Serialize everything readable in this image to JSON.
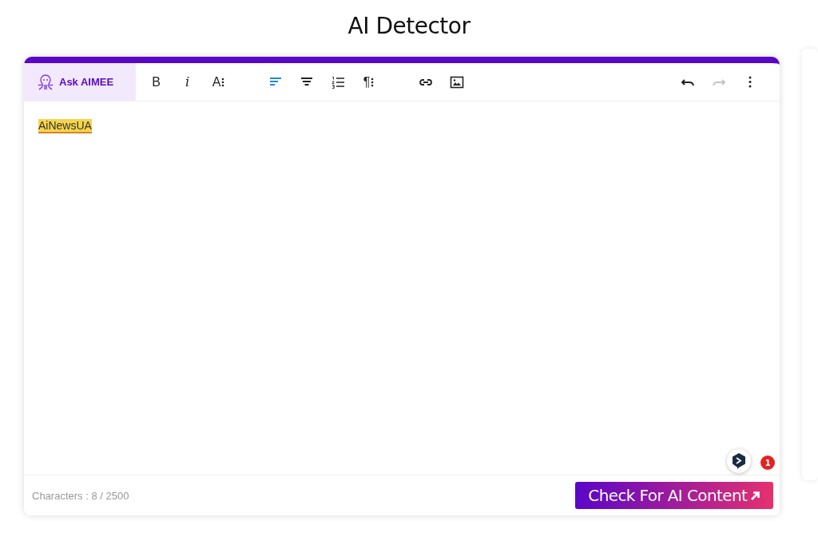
{
  "page_title": "AI Detector",
  "toolbar": {
    "ask_button": {
      "label": "Ask AIMEE"
    },
    "tools": [
      {
        "kind": "bold",
        "label": "B",
        "active": false,
        "disabled": false
      },
      {
        "kind": "italic",
        "label": "i",
        "active": false,
        "disabled": false
      },
      {
        "kind": "fontsize",
        "label": "A",
        "active": false,
        "disabled": false
      },
      {
        "kind": "gap"
      },
      {
        "kind": "alignleft",
        "active": true,
        "disabled": false
      },
      {
        "kind": "aligncenter",
        "active": false,
        "disabled": false
      },
      {
        "kind": "numbered",
        "active": false,
        "disabled": false
      },
      {
        "kind": "paragraph",
        "label": "¶",
        "active": false,
        "disabled": false
      },
      {
        "kind": "gap"
      },
      {
        "kind": "link",
        "active": false,
        "disabled": false
      },
      {
        "kind": "image",
        "active": false,
        "disabled": false
      },
      {
        "kind": "spacer"
      },
      {
        "kind": "undo",
        "active": false,
        "disabled": false
      },
      {
        "kind": "redo",
        "active": false,
        "disabled": true
      },
      {
        "kind": "more",
        "active": false,
        "disabled": false
      }
    ]
  },
  "editor": {
    "text": "AiNewsUA",
    "highlighted": true
  },
  "chat_widget": {
    "badge": "1"
  },
  "footer": {
    "counter": "Characters : 8  / 2500",
    "button": "Check For AI Content"
  }
}
